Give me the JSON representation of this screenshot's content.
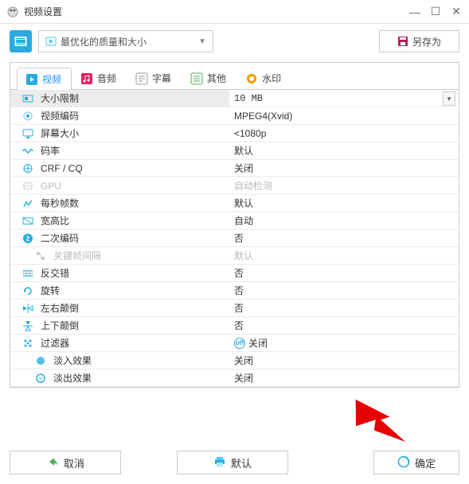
{
  "window": {
    "title": "视频设置"
  },
  "toolbar": {
    "preset": "最优化的质量和大小",
    "saveas": "另存为"
  },
  "tabs": [
    {
      "label": "视频",
      "color": "#29abe2"
    },
    {
      "label": "音频",
      "color": "#e91e63"
    },
    {
      "label": "字幕",
      "color": "#9c27b0"
    },
    {
      "label": "其他",
      "color": "#4caf50"
    },
    {
      "label": "水印",
      "color": "#ff9800"
    }
  ],
  "rows": [
    {
      "label": "大小限制",
      "value": "10 MB",
      "mono": true,
      "highlight": true,
      "combo": true,
      "icon": "size"
    },
    {
      "label": "视频编码",
      "value": "MPEG4(Xvid)",
      "icon": "codec"
    },
    {
      "label": "屏幕大小",
      "value": "<1080p",
      "icon": "screen"
    },
    {
      "label": "码率",
      "value": "默认",
      "icon": "bitrate"
    },
    {
      "label": "CRF / CQ",
      "value": "关闭",
      "icon": "crf"
    },
    {
      "label": "GPU",
      "value": "自动检测",
      "icon": "gpu",
      "disabled": true
    },
    {
      "label": "每秒帧数",
      "value": "默认",
      "icon": "fps"
    },
    {
      "label": "宽高比",
      "value": "自动",
      "icon": "aspect"
    },
    {
      "label": "二次编码",
      "value": "否",
      "icon": "twopass"
    },
    {
      "label": "关键帧间隔",
      "value": "默认",
      "icon": "keyframe",
      "disabled": true,
      "indent": true
    },
    {
      "label": "反交错",
      "value": "否",
      "icon": "deint"
    },
    {
      "label": "旋转",
      "value": "否",
      "icon": "rotate"
    },
    {
      "label": "左右颠倒",
      "value": "否",
      "icon": "fliph"
    },
    {
      "label": "上下颠倒",
      "value": "否",
      "icon": "flipv"
    },
    {
      "label": "过滤器",
      "value": "关闭",
      "icon": "filter",
      "badge": true
    },
    {
      "label": "淡入效果",
      "value": "关闭",
      "icon": "fadein",
      "indent": true
    },
    {
      "label": "淡出效果",
      "value": "关闭",
      "icon": "fadeout",
      "indent": true
    }
  ],
  "footer": {
    "cancel": "取消",
    "default": "默认",
    "ok": "确定"
  }
}
